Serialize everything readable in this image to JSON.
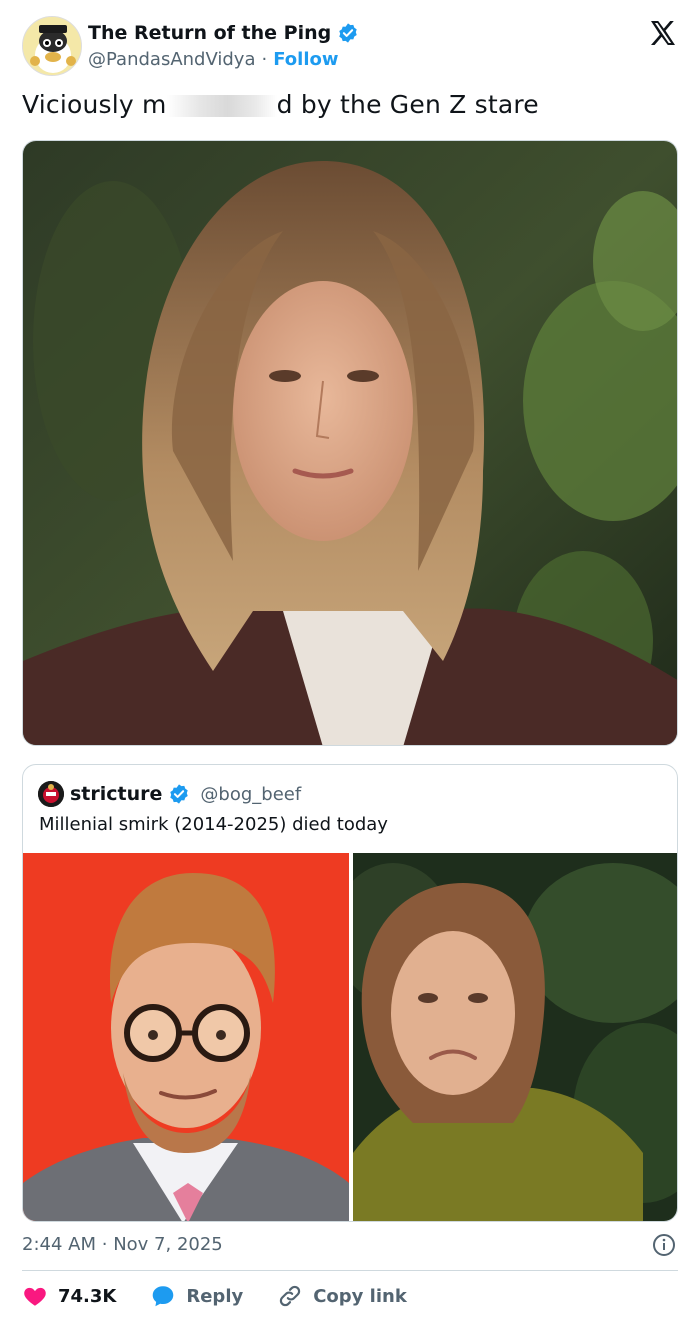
{
  "author": {
    "display_name": "The Return of the Ping",
    "handle": "@PandasAndVidya",
    "separator": "·",
    "follow_label": "Follow",
    "avatar_icon": "cartoon-character-avatar"
  },
  "tweet": {
    "text_before": "Viciously m",
    "text_after": "d by the Gen Z stare",
    "image_alt": "woman with long hair in brown leather jacket"
  },
  "quote": {
    "display_name": "stricture",
    "handle": "@bog_beef",
    "text": "Millenial smirk (2014-2025) died today"
  },
  "meta": {
    "time": "2:44 AM",
    "separator": "·",
    "date": "Nov 7, 2025"
  },
  "actions": {
    "likes_count": "74.3K",
    "reply_label": "Reply",
    "copy_label": "Copy link"
  },
  "colors": {
    "accent": "#1d9bf0",
    "like": "#f91880",
    "text": "#0f1419",
    "muted": "#536471"
  }
}
